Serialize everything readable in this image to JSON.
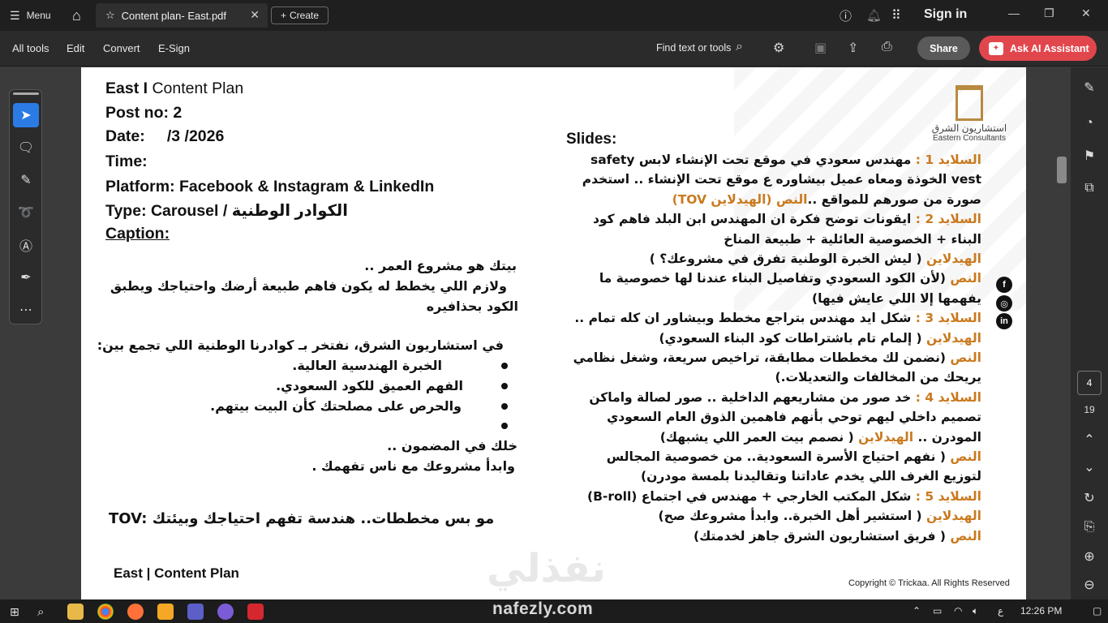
{
  "titlebar": {
    "menu_label": "Menu",
    "tab_title": "Content plan- East.pdf",
    "tab_close": "✕",
    "create_label": "Create",
    "signin_label": "Sign in"
  },
  "toolbar": {
    "all_tools": "All tools",
    "edit": "Edit",
    "convert": "Convert",
    "esign": "E-Sign",
    "find": "Find text or tools",
    "share": "Share",
    "ask_ai": "Ask AI Assistant"
  },
  "pager": {
    "current": "4",
    "total": "19"
  },
  "doc": {
    "logo_ar": "استشاريون الشرق",
    "logo_en": "Eastern Consultants",
    "head1_bold": "East I",
    "head1_light": " Content Plan",
    "post_no": "Post no: 2",
    "date": "Date:     /3 /2026",
    "time": "Time:",
    "platform": "Platform: Facebook & Instagram & LinkedIn",
    "type": "Type: Carousel / الكوادر الوطنية",
    "caption": "Caption:",
    "cap1": "بيتك هو مشروع العمر ..",
    "cap2": "ولازم اللي يخطط له يكون فاهم طبيعة أرضك واحتياجك ويطبق",
    "cap3": "الكود بحذافيره",
    "cap4": "في استشاريون الشرق، نفتخر بـ كوادرنا الوطنية اللي تجمع بين:",
    "bul1": "الخبرة الهندسية العالية.",
    "bul2": "الفهم العميق للكود السعودي.",
    "bul3": "والحرص على مصلحتك كأن البيت بيتهم.",
    "cap5": "خلك في المضمون ..",
    "cap6": "وابدأ مشروعك مع ناس تفهمك .",
    "tov": "TOV:  مو بس مخططات.. هندسة تفهم احتياجك وبيئتك",
    "footer": "East | Content Plan",
    "copyright": "Copyright © Trickaa. All Rights Reserved",
    "watermark": "نفذلي",
    "slides_title": "Slides:",
    "slides": [
      {
        "o": "السلايد 1 : ",
        "t": "مهندس سعودي في موقع تحت الإنشاء لابس safety"
      },
      {
        "o": "",
        "t": "vest الخوذة ومعاه عميل بيشاوره ع موقع تحت الإنشاء .. استخدم"
      },
      {
        "o": "",
        "t": "صورة من صورهم للمواقع ..",
        "o2": "النص (الهيدلاين TOV)"
      },
      {
        "o": "السلايد 2 : ",
        "t": "ايقونات توضح فكرة ان المهندس ابن البلد فاهم كود"
      },
      {
        "o": "",
        "t": "البناء + الخصوصية العائلية + طبيعة المناخ"
      },
      {
        "o": "الهيدلاين ",
        "t": "( ليش الخبرة الوطنية تفرق في مشروعك؟ )"
      },
      {
        "o": "النص ",
        "t": "(لأن الكود السعودي وتفاصيل البناء عندنا لها خصوصية ما"
      },
      {
        "o": "",
        "t": "يفهمها إلا اللي عايش فيها)"
      },
      {
        "o": "السلايد 3 : ",
        "t": "شكل ايد مهندس بتراجع مخطط وبيشاور ان كله تمام .."
      },
      {
        "o": "الهيدلاين ",
        "t": "( إلمام تام باشتراطات كود البناء السعودي)"
      },
      {
        "o": "النص ",
        "t": "(نضمن لك مخططات مطابقة، تراخيص سريعة، وشغل نظامي"
      },
      {
        "o": "",
        "t": "يريحك من المخالفات والتعديلات.)"
      },
      {
        "o": "السلايد 4 : ",
        "t": "خد صور من مشاريعهم الداخلية .. صور لصالة واماكن"
      },
      {
        "o": "",
        "t": "تصميم داخلي ليهم توحي بأنهم فاهمين الذوق العام السعودي"
      },
      {
        "o": "",
        "t": "المودرن .. ",
        "o2": "الهيدلاين",
        "t2": " ( نصمم بيت العمر اللي يشبهك)"
      },
      {
        "o": "النص ",
        "t": "( نفهم احتياج الأسرة السعودية.. من خصوصية المجالس"
      },
      {
        "o": "",
        "t": "لتوزيع الغرف اللي يخدم عاداتنا وتقاليدنا بلمسة مودرن)"
      },
      {
        "o": "السلايد 5 : ",
        "t": "شكل المكتب الخارجي + مهندس في اجتماع (B-roll)"
      },
      {
        "o": "الهيدلاين ",
        "t": "( استشير أهل الخبرة.. وابدأ مشروعك صح)"
      },
      {
        "o": "النص ",
        "t": "( فريق استشاريون الشرق جاهز لخدمتك)"
      }
    ]
  },
  "taskbar": {
    "time": "12:26 PM",
    "lang": "ع",
    "brand": "nafezly.com"
  }
}
